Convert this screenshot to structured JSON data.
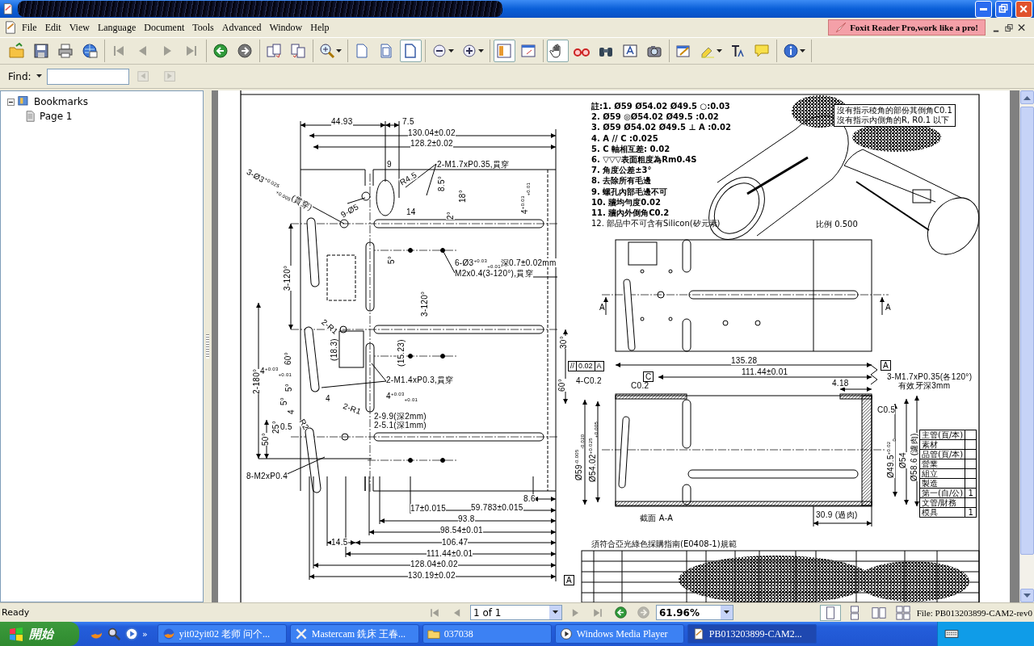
{
  "title_bar": {
    "redacted": true
  },
  "menu_bar": {
    "items": [
      "File",
      "Edit",
      "View",
      "Language",
      "Document",
      "Tools",
      "Advanced",
      "Window",
      "Help"
    ],
    "banner": "Foxit Reader Pro,work like a pro!"
  },
  "toolbar": [
    {
      "selected": false,
      "disabled": false,
      "dropdown": false
    },
    {
      "selected": false,
      "disabled": false,
      "dropdown": false
    },
    {
      "selected": false,
      "disabled": false,
      "dropdown": false
    },
    {
      "selected": false,
      "disabled": false,
      "dropdown": false
    },
    {
      "selected": false,
      "disabled": true,
      "dropdown": false
    },
    {
      "selected": false,
      "disabled": true,
      "dropdown": false
    },
    {
      "selected": false,
      "disabled": true,
      "dropdown": false
    },
    {
      "selected": false,
      "disabled": true,
      "dropdown": false
    },
    {
      "selected": false,
      "disabled": false,
      "dropdown": false
    },
    {
      "selected": false,
      "disabled": false,
      "dropdown": false
    },
    {
      "selected": false,
      "disabled": false,
      "dropdown": false
    },
    {
      "selected": false,
      "disabled": false,
      "dropdown": false
    },
    {
      "selected": false,
      "disabled": false,
      "dropdown": true
    },
    {
      "selected": false,
      "disabled": false,
      "dropdown": false
    },
    {
      "selected": false,
      "disabled": false,
      "dropdown": false
    },
    {
      "selected": true,
      "disabled": false,
      "dropdown": false
    },
    {
      "selected": false,
      "disabled": false,
      "dropdown": true
    },
    {
      "selected": false,
      "disabled": false,
      "dropdown": true
    },
    {
      "selected": true,
      "disabled": false,
      "dropdown": false
    },
    {
      "selected": false,
      "disabled": false,
      "dropdown": false
    },
    {
      "selected": true,
      "disabled": false,
      "dropdown": false
    },
    {
      "selected": false,
      "disabled": false,
      "dropdown": false
    },
    {
      "selected": false,
      "disabled": false,
      "dropdown": false
    },
    {
      "selected": false,
      "disabled": false,
      "dropdown": false
    },
    {
      "selected": false,
      "disabled": false,
      "dropdown": false
    },
    {
      "selected": false,
      "disabled": false,
      "dropdown": false
    },
    {
      "selected": false,
      "disabled": false,
      "dropdown": true
    },
    {
      "selected": false,
      "disabled": false,
      "dropdown": false
    },
    {
      "selected": false,
      "disabled": false,
      "dropdown": false
    },
    {
      "selected": false,
      "disabled": false,
      "dropdown": true
    }
  ],
  "find_bar": {
    "label": "Find:",
    "buttons": [
      {
        "disabled": true
      },
      {
        "disabled": true
      }
    ]
  },
  "bookmarks": [
    {
      "label": "Bookmarks",
      "expanded": true,
      "children": [
        {
          "label": "Page 1"
        }
      ]
    }
  ],
  "document": {
    "dimension_labels": [
      "44.93",
      "7.5",
      "130.04±0.02",
      "128.2±0.02",
      "9",
      "R4.5",
      "2-M1.7xP0.35,貫穿",
      "8.5°",
      "18°",
      "14",
      "2°",
      "9-Ø5",
      "3-Ø3$^{+0.025}$$_{+0.005}$(貫穿)",
      "4$^{+0.03}$$_{+0.01}$",
      "5°",
      "6-Ø3$^{+0.03}$$_{+0.01}$深0.7±0.02mm",
      "M2x0.4(3-120°),貫穿",
      "3-120°",
      "3-120°",
      "2-R1",
      "30°",
      "(18.3)",
      "(15.23)",
      "60°",
      "2-180°",
      "4$^{+0.03}$$_{+0.01}$",
      "5°",
      "5°",
      "2-M1.4xP0.3,貫穿",
      "4",
      "4$^{+0.03}$$_{+0.01}$",
      "2-R1",
      "4",
      "0.5",
      "2-9.9(深2mm)",
      "2-5.1(深1mm)",
      "25°",
      "R2",
      "50°",
      "60°",
      "8-M2xP0.4",
      "8.6",
      "17±0.015",
      "59.783±0.015",
      "93.8",
      "98.54±0.01",
      "14.5",
      "106.47",
      "111.44±0.01",
      "128.04±0.02",
      "130.19±0.02",
      "A",
      "A",
      "135.28",
      "111.44±0.01",
      "4.18",
      "3-M1.7xP0.35(各120°)",
      "有效牙深3mm",
      "4-C0.2",
      "C0.2",
      "C0.5",
      "Ø59$^{-0.005}$$_{-0.020}$",
      "Ø54.02$^{+0.025}$$_{+0.005}$",
      "Ø49.5$^{+0.02}$$_{0}$",
      "Ø54",
      "Ø58.6 (濾肉)",
      "截面 A-A",
      "30.9 (過肉)"
    ],
    "datum_marks": [
      {
        "kind": "datum",
        "text": "A"
      },
      {
        "kind": "datum",
        "text": "A"
      },
      {
        "kind": "datum",
        "text": "C"
      },
      {
        "kind": "tolerance",
        "cells": [
          "//",
          "0.02",
          "A"
        ]
      }
    ],
    "notes": [
      "註:1. Ø59 Ø54.02 Ø49.5 ○:0.03",
      "2. Ø59 ◎Ø54.02 Ø49.5 :0.02",
      "3. Ø59 Ø54.02 Ø49.5 ⊥ A :0.02",
      "4. A // C :0.025",
      "5. C 軸相互差: 0.02",
      "6. ▽▽▽表面粗度為Rm0.4S",
      "7. 角度公差±3°",
      "8. 去除所有毛邊",
      "9. 螺孔內部毛邊不可",
      "10. 牆均勻度0.02",
      "11. 牆內外倒角C0.2",
      "12. 部品中不可含有Silicon(矽元素)"
    ],
    "note_box": [
      "沒有指示稜角的部份其倒角C0.1",
      "沒有指示內側角的R, R0.1 以下"
    ],
    "scale_label": "比例 0.500",
    "spec_note": "須符合亞光綠色採購指南(E0408-1)規範",
    "parts_table": [
      {
        "label": "主管(頁/本)"
      },
      {
        "label": "素材"
      },
      {
        "label": "品管(頁/本)"
      },
      {
        "label": "營業"
      },
      {
        "label": "組立"
      },
      {
        "label": "製造"
      },
      {
        "label": "第一(自/公)",
        "value": "1"
      },
      {
        "label": "文管/財務"
      },
      {
        "label": "模具",
        "value": "1"
      }
    ]
  },
  "status_bar": {
    "text": "Ready",
    "nav": [
      {
        "disabled": true
      },
      {
        "disabled": true
      },
      {
        "disabled": true
      },
      {
        "disabled": true
      }
    ],
    "page": "1 of 1",
    "history": [
      {
        "disabled": false
      },
      {
        "disabled": true
      }
    ],
    "zoom": "61.96%",
    "views": [
      {
        "selected": true
      },
      {
        "selected": false
      },
      {
        "selected": false
      },
      {
        "selected": false
      }
    ],
    "file": "File: PB013203899-CAM2-rev0"
  },
  "taskbar": {
    "start": "開始",
    "quick_launch_more": "»",
    "tasks": [
      {
        "label": "yit02yit02 老师 问个...",
        "selected": false
      },
      {
        "label": "Mastercam 銑床 王春...",
        "selected": false
      },
      {
        "label": "037038",
        "selected": false
      },
      {
        "label": "Windows Media Player",
        "selected": false
      },
      {
        "label": "PB013203899-CAM2...",
        "selected": true
      }
    ]
  }
}
